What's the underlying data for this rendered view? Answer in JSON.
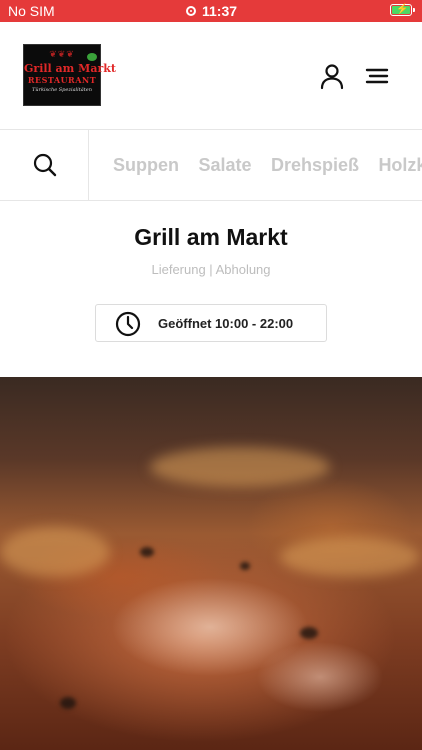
{
  "status_bar": {
    "carrier": "No SIM",
    "time": "11:37"
  },
  "header": {
    "logo": {
      "line1": "Grill am Markt",
      "line2": "RESTAURANT",
      "line3": "Türkische Spezialitäten"
    }
  },
  "categories": [
    "Suppen",
    "Salate",
    "Drehspieß",
    "Holzkohle"
  ],
  "restaurant": {
    "name": "Grill am Markt",
    "services": "Lieferung | Abholung",
    "hours": "Geöffnet 10:00 - 22:00"
  },
  "colors": {
    "accent": "#e53a3a",
    "category_text": "#c9c9c9",
    "subtitle_text": "#bdbdbd"
  },
  "icons": [
    "user-icon",
    "menu-icon",
    "search-icon",
    "clock-icon"
  ]
}
